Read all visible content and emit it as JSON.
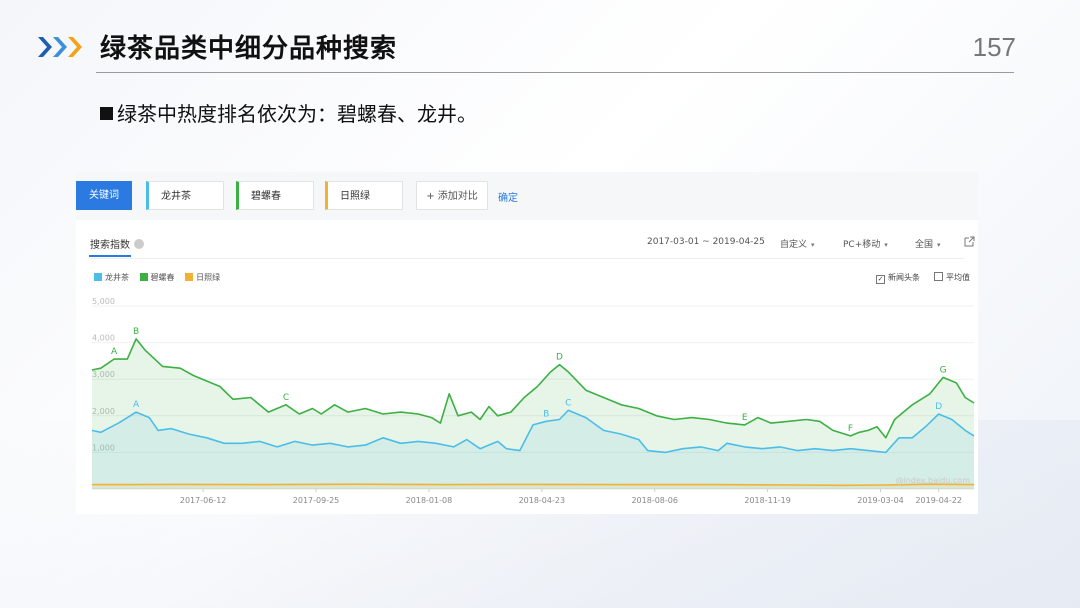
{
  "slide": {
    "title": "绿茶品类中细分品种搜索",
    "page_number": "157",
    "bullet": "绿茶中热度排名依次为：碧螺春、龙井。"
  },
  "toolbar": {
    "keyword_button": "关键词",
    "keywords": [
      {
        "label": "龙井茶",
        "color": "#4bbde8"
      },
      {
        "label": "碧螺春",
        "color": "#3cb043"
      },
      {
        "label": "日照绿",
        "color": "#f2b134"
      }
    ],
    "add_compare": "+ 添加对比",
    "confirm": "确定"
  },
  "panel": {
    "index_title": "搜索指数",
    "date_range": "2017-03-01 ~ 2019-04-25",
    "custom": "自定义",
    "device": "PC+移动",
    "region": "全国",
    "option_news": "新闻头条",
    "option_avg": "平均值",
    "watermark": "@index.baidu.com"
  },
  "chart_data": {
    "type": "area",
    "y_ticks": [
      "5,000",
      "4,000",
      "3,000",
      "2,000",
      "1,000"
    ],
    "ylim": [
      0,
      5000
    ],
    "x_tick_labels": [
      "2017-06-12",
      "2017-09-25",
      "2018-01-08",
      "2018-04-23",
      "2018-08-06",
      "2018-11-19",
      "2019-03-04",
      "2019-04-22"
    ],
    "x_tick_positions": [
      0.126,
      0.254,
      0.382,
      0.51,
      0.638,
      0.766,
      0.894,
      0.96
    ],
    "series": [
      {
        "name": "碧螺春",
        "color": "#3cb043",
        "points": [
          [
            0,
            3250
          ],
          [
            0.01,
            3300
          ],
          [
            0.025,
            3550
          ],
          [
            0.04,
            3550
          ],
          [
            0.05,
            4100
          ],
          [
            0.06,
            3800
          ],
          [
            0.08,
            3350
          ],
          [
            0.1,
            3300
          ],
          [
            0.115,
            3100
          ],
          [
            0.13,
            2950
          ],
          [
            0.145,
            2800
          ],
          [
            0.16,
            2450
          ],
          [
            0.18,
            2500
          ],
          [
            0.2,
            2100
          ],
          [
            0.22,
            2300
          ],
          [
            0.235,
            2050
          ],
          [
            0.25,
            2200
          ],
          [
            0.26,
            2050
          ],
          [
            0.275,
            2300
          ],
          [
            0.29,
            2100
          ],
          [
            0.31,
            2200
          ],
          [
            0.33,
            2050
          ],
          [
            0.35,
            2100
          ],
          [
            0.37,
            2050
          ],
          [
            0.385,
            1950
          ],
          [
            0.395,
            1800
          ],
          [
            0.405,
            2600
          ],
          [
            0.415,
            2000
          ],
          [
            0.43,
            2100
          ],
          [
            0.44,
            1900
          ],
          [
            0.45,
            2250
          ],
          [
            0.46,
            2000
          ],
          [
            0.475,
            2100
          ],
          [
            0.49,
            2500
          ],
          [
            0.505,
            2800
          ],
          [
            0.52,
            3200
          ],
          [
            0.53,
            3400
          ],
          [
            0.54,
            3200
          ],
          [
            0.56,
            2700
          ],
          [
            0.58,
            2500
          ],
          [
            0.6,
            2300
          ],
          [
            0.62,
            2200
          ],
          [
            0.64,
            2000
          ],
          [
            0.66,
            1900
          ],
          [
            0.68,
            1950
          ],
          [
            0.7,
            1900
          ],
          [
            0.72,
            1800
          ],
          [
            0.74,
            1750
          ],
          [
            0.755,
            1950
          ],
          [
            0.77,
            1800
          ],
          [
            0.79,
            1850
          ],
          [
            0.81,
            1900
          ],
          [
            0.825,
            1850
          ],
          [
            0.84,
            1600
          ],
          [
            0.86,
            1450
          ],
          [
            0.87,
            1550
          ],
          [
            0.88,
            1600
          ],
          [
            0.89,
            1700
          ],
          [
            0.9,
            1400
          ],
          [
            0.91,
            1900
          ],
          [
            0.93,
            2300
          ],
          [
            0.95,
            2600
          ],
          [
            0.965,
            3050
          ],
          [
            0.98,
            2900
          ],
          [
            0.99,
            2500
          ],
          [
            1.0,
            2350
          ]
        ]
      },
      {
        "name": "龙井茶",
        "color": "#4bbde8",
        "points": [
          [
            0,
            1600
          ],
          [
            0.01,
            1550
          ],
          [
            0.03,
            1800
          ],
          [
            0.05,
            2100
          ],
          [
            0.065,
            1950
          ],
          [
            0.075,
            1600
          ],
          [
            0.09,
            1650
          ],
          [
            0.11,
            1500
          ],
          [
            0.13,
            1400
          ],
          [
            0.15,
            1250
          ],
          [
            0.17,
            1250
          ],
          [
            0.19,
            1300
          ],
          [
            0.21,
            1150
          ],
          [
            0.23,
            1300
          ],
          [
            0.25,
            1200
          ],
          [
            0.27,
            1250
          ],
          [
            0.29,
            1150
          ],
          [
            0.31,
            1200
          ],
          [
            0.33,
            1400
          ],
          [
            0.35,
            1250
          ],
          [
            0.37,
            1300
          ],
          [
            0.39,
            1250
          ],
          [
            0.41,
            1150
          ],
          [
            0.425,
            1350
          ],
          [
            0.44,
            1100
          ],
          [
            0.46,
            1300
          ],
          [
            0.47,
            1100
          ],
          [
            0.485,
            1050
          ],
          [
            0.5,
            1750
          ],
          [
            0.515,
            1850
          ],
          [
            0.53,
            1900
          ],
          [
            0.54,
            2150
          ],
          [
            0.56,
            1950
          ],
          [
            0.58,
            1600
          ],
          [
            0.6,
            1500
          ],
          [
            0.62,
            1350
          ],
          [
            0.63,
            1050
          ],
          [
            0.65,
            1000
          ],
          [
            0.67,
            1100
          ],
          [
            0.69,
            1150
          ],
          [
            0.71,
            1050
          ],
          [
            0.72,
            1250
          ],
          [
            0.74,
            1150
          ],
          [
            0.76,
            1100
          ],
          [
            0.78,
            1150
          ],
          [
            0.8,
            1050
          ],
          [
            0.82,
            1100
          ],
          [
            0.84,
            1050
          ],
          [
            0.86,
            1100
          ],
          [
            0.88,
            1050
          ],
          [
            0.9,
            1000
          ],
          [
            0.915,
            1400
          ],
          [
            0.93,
            1400
          ],
          [
            0.945,
            1700
          ],
          [
            0.96,
            2050
          ],
          [
            0.975,
            1900
          ],
          [
            0.99,
            1600
          ],
          [
            1.0,
            1450
          ]
        ]
      },
      {
        "name": "日照绿",
        "color": "#f2b134",
        "points": [
          [
            0,
            120
          ],
          [
            0.1,
            125
          ],
          [
            0.2,
            120
          ],
          [
            0.3,
            130
          ],
          [
            0.4,
            120
          ],
          [
            0.5,
            125
          ],
          [
            0.6,
            120
          ],
          [
            0.7,
            120
          ],
          [
            0.8,
            110
          ],
          [
            0.85,
            100
          ],
          [
            0.9,
            110
          ],
          [
            0.95,
            130
          ],
          [
            1.0,
            120
          ]
        ]
      }
    ],
    "annotations": [
      {
        "label": "A",
        "series": "碧螺春",
        "x": 0.025,
        "y": 3550
      },
      {
        "label": "B",
        "series": "碧螺春",
        "x": 0.05,
        "y": 4100
      },
      {
        "label": "C",
        "series": "碧螺春",
        "x": 0.22,
        "y": 2300
      },
      {
        "label": "D",
        "series": "碧螺春",
        "x": 0.53,
        "y": 3400
      },
      {
        "label": "E",
        "series": "碧螺春",
        "x": 0.74,
        "y": 1750
      },
      {
        "label": "F",
        "series": "碧螺春",
        "x": 0.86,
        "y": 1450
      },
      {
        "label": "G",
        "series": "碧螺春",
        "x": 0.965,
        "y": 3050
      },
      {
        "label": "A",
        "series": "龙井茶",
        "x": 0.05,
        "y": 2100
      },
      {
        "label": "B",
        "series": "龙井茶",
        "x": 0.515,
        "y": 1850
      },
      {
        "label": "C",
        "series": "龙井茶",
        "x": 0.54,
        "y": 2150
      },
      {
        "label": "D",
        "series": "龙井茶",
        "x": 0.96,
        "y": 2050
      }
    ]
  }
}
